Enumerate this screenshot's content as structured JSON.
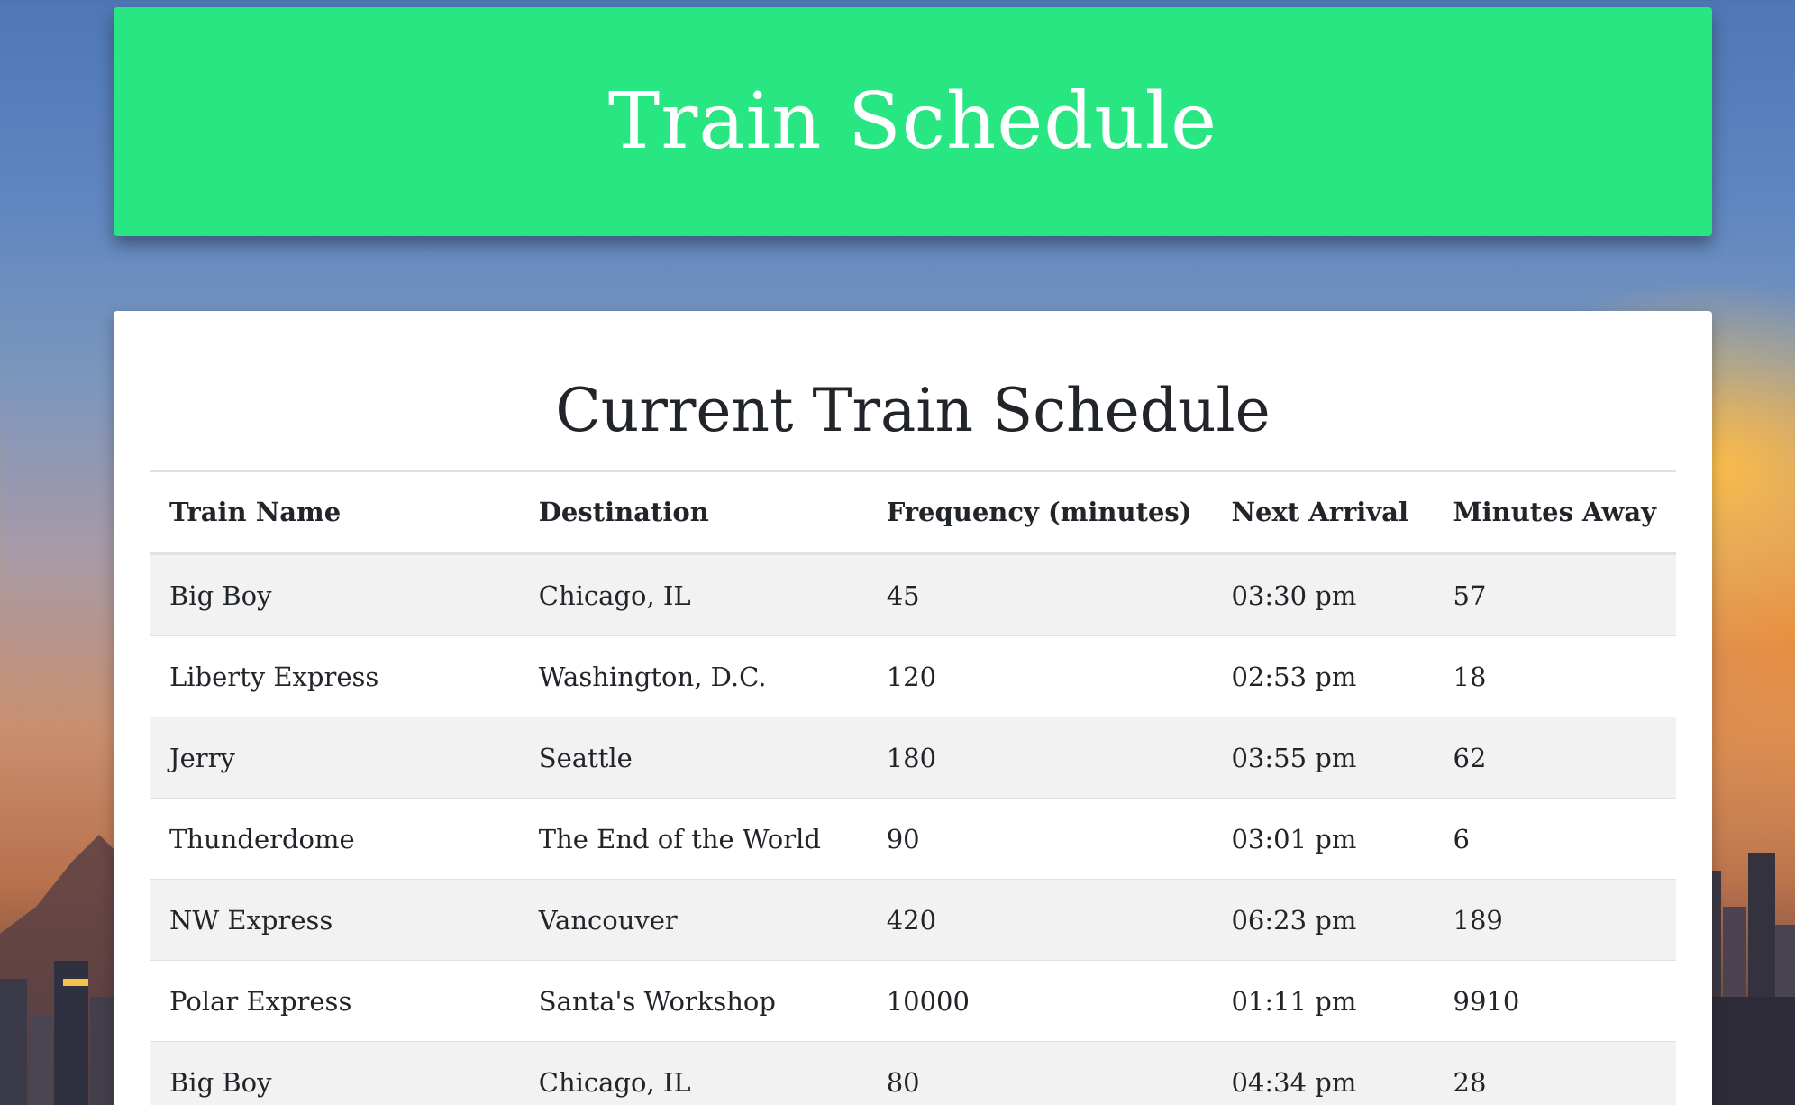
{
  "header": {
    "title": "Train Schedule"
  },
  "schedule": {
    "title": "Current Train Schedule",
    "columns": [
      "Train Name",
      "Destination",
      "Frequency (minutes)",
      "Next Arrival",
      "Minutes Away"
    ],
    "rows": [
      [
        "Big Boy",
        "Chicago, IL",
        "45",
        "03:30 pm",
        "57"
      ],
      [
        "Liberty Express",
        "Washington, D.C.",
        "120",
        "02:53 pm",
        "18"
      ],
      [
        "Jerry",
        "Seattle",
        "180",
        "03:55 pm",
        "62"
      ],
      [
        "Thunderdome",
        "The End of the World",
        "90",
        "03:01 pm",
        "6"
      ],
      [
        "NW Express",
        "Vancouver",
        "420",
        "06:23 pm",
        "189"
      ],
      [
        "Polar Express",
        "Santa's Workshop",
        "10000",
        "01:11 pm",
        "9910"
      ],
      [
        "Big Boy",
        "Chicago, IL",
        "80",
        "04:34 pm",
        "28"
      ]
    ]
  },
  "colors": {
    "header_background": "#28e681",
    "header_text": "#ffffff",
    "panel_background": "#ffffff",
    "row_stripe": "#f2f2f2",
    "text": "#212529"
  }
}
